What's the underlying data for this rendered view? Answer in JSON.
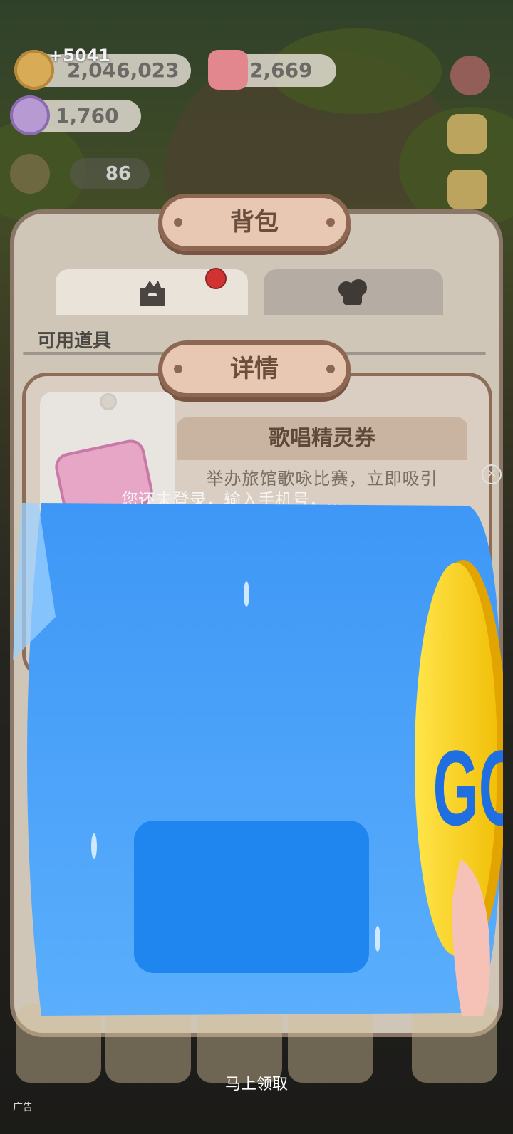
{
  "resources": {
    "coins_delta": "+5041",
    "coins": "2,046,023",
    "hearts": "2,669",
    "gems": "1,760",
    "small_count": "86"
  },
  "backpack": {
    "title": "背包",
    "tabs": [
      {
        "icon": "box-icon"
      },
      {
        "icon": "chef-hat-icon"
      }
    ],
    "section_label": "可用道具"
  },
  "detail": {
    "title": "详情",
    "item_name": "歌唱精灵券",
    "item_description": "举办旅馆歌咏比赛，立即吸引"
  },
  "ad": {
    "prompt": "您还未登录，输入手机号，…",
    "go_text": "GO",
    "cta": "马上领取",
    "label": "广告",
    "colors": {
      "card": "#3d9bf7",
      "go_coin": "#ffd21a",
      "go_text": "#1f6fe0"
    }
  }
}
